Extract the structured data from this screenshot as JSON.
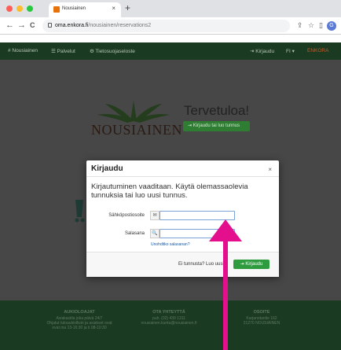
{
  "browser": {
    "tab_title": "Nousiainen",
    "tab_close": "×",
    "new_tab": "+",
    "back": "←",
    "forward": "→",
    "reload": "C",
    "url_domain": "oma.enkora.fi",
    "url_path": "/nousiainen/reservations2",
    "profile_initial": "G",
    "colors": {
      "close": "#ff5f57",
      "minimize": "#febc2e",
      "maximize": "#28c840"
    }
  },
  "site_nav": {
    "items": [
      "# Nousiainen",
      "☰ Palvelut",
      "⚙ Tietosuojaseloste"
    ],
    "right_items": [
      "⇥ Kirjaudu",
      "FI ▾",
      "ENKORA"
    ]
  },
  "hero": {
    "brand": "NOUSIAINEN",
    "title": "Tervetuloa!",
    "login_button": "⇥ Kirjaudu tai luo tunnus"
  },
  "modal": {
    "title": "Kirjaudu",
    "close": "×",
    "message": "Kirjautuminen vaaditaan. Käytä olemassaolevia tunnuksia tai luo uusi tunnus.",
    "email_label": "Sähköpostiosoite",
    "email_value": "",
    "email_icon": "✉",
    "password_label": "Salasana",
    "password_value": "",
    "password_icon": "🔍",
    "forgot_link": "Unohditko salasanan?",
    "no_account": "Ei tunnusta? Luo uusi",
    "login_button": "⇥ Kirjaudu"
  },
  "footer": {
    "opening": {
      "title": "AUKIOLOAJAT",
      "lines": [
        "Asiakastila joka päivä 24/7",
        "Ohjatut tuloaukiollisin ja asiakset ovat",
        "ovat ma 13-16:30 ja ti 08-10:30"
      ]
    },
    "contact": {
      "title": "OTA YHTEYTTÄ",
      "lines": [
        "puh. (02) 439 1311",
        "nousiainen.kunta@nousiainen.fi"
      ]
    },
    "address": {
      "title": "OSOITE",
      "lines": [
        "Karjanotantie 162",
        "21270 NOUSIAINEN"
      ]
    }
  },
  "annotation": {
    "arrow_color": "#e40f8c"
  }
}
